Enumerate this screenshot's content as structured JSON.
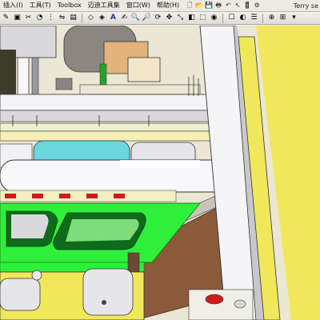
{
  "menubar": {
    "items": [
      "插入(I)",
      "工具(T)",
      "Toolbox",
      "迈迪工具集",
      "窗口(W)",
      "帮助(H)"
    ],
    "user": "Terry se"
  },
  "toolbar": {
    "text_tool": "A"
  },
  "colors": {
    "window_bg": "#eceae4",
    "model_green": "#2ef03a",
    "model_cyan": "#6ad7df",
    "model_yellow": "#f0e85a",
    "model_brown": "#8a5a3a",
    "model_red": "#d11a1a"
  }
}
